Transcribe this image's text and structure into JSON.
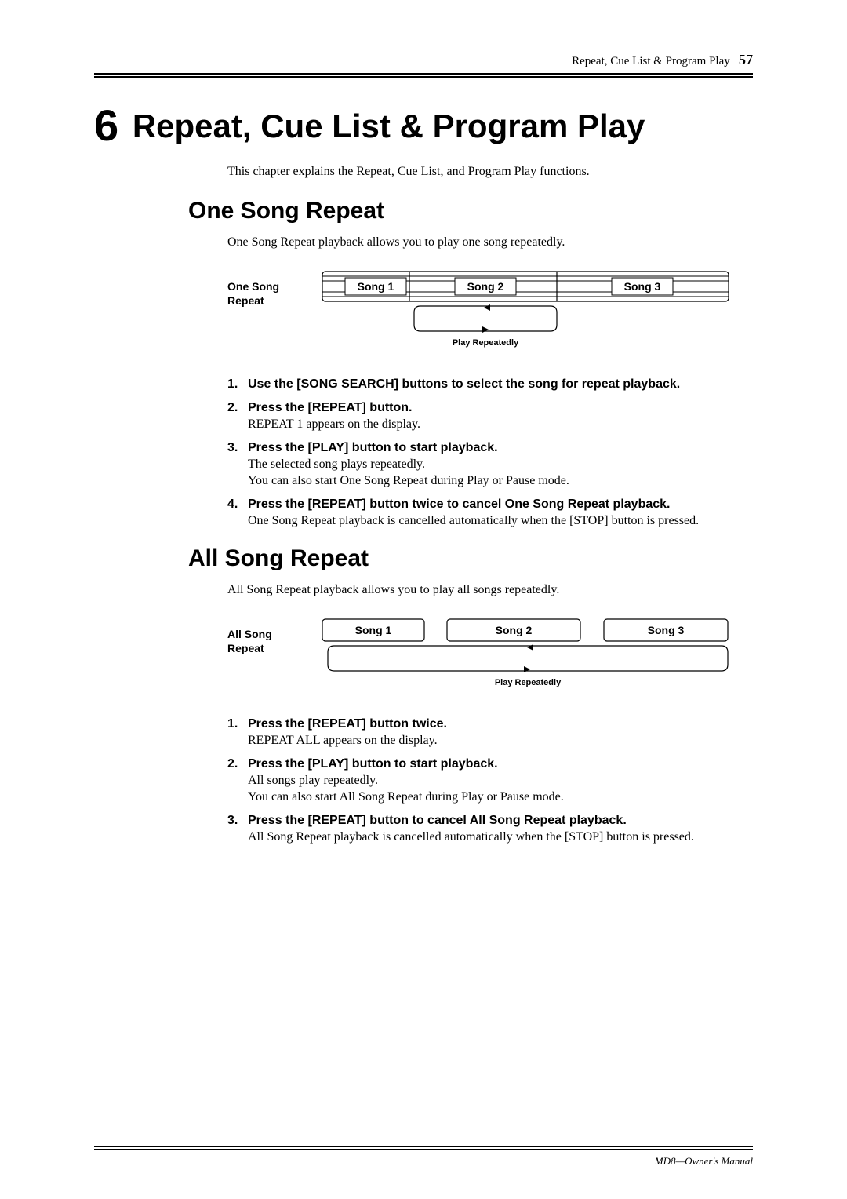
{
  "header": {
    "running_title": "Repeat, Cue List & Program Play",
    "page_number": "57"
  },
  "chapter": {
    "number": "6",
    "title": "Repeat, Cue List & Program Play",
    "intro": "This chapter explains the Repeat, Cue List, and Program Play functions."
  },
  "sections": [
    {
      "heading": "One Song Repeat",
      "intro": "One Song Repeat playback allows you to play one song repeatedly.",
      "diagram": {
        "label_line1": "One Song",
        "label_line2": "Repeat",
        "songs": [
          "Song 1",
          "Song 2",
          "Song 3"
        ],
        "caption": "Play Repeatedly"
      },
      "steps": [
        {
          "num": "1.",
          "head": "Use the [SONG SEARCH] buttons to select the song for repeat playback.",
          "body": []
        },
        {
          "num": "2.",
          "head": "Press the [REPEAT] button.",
          "body": [
            "REPEAT 1 appears on the display."
          ]
        },
        {
          "num": "3.",
          "head": "Press the [PLAY] button to start playback.",
          "body": [
            "The selected song plays repeatedly.",
            "You can also start One Song Repeat during Play or Pause mode."
          ]
        },
        {
          "num": "4.",
          "head": "Press the [REPEAT] button twice to cancel One Song Repeat playback.",
          "body": [
            "One Song Repeat playback is cancelled automatically when the [STOP] button is pressed."
          ]
        }
      ]
    },
    {
      "heading": "All Song Repeat",
      "intro": "All Song Repeat playback allows you to play all songs repeatedly.",
      "diagram": {
        "label_line1": "All Song",
        "label_line2": "Repeat",
        "songs": [
          "Song 1",
          "Song 2",
          "Song 3"
        ],
        "caption": "Play Repeatedly"
      },
      "steps": [
        {
          "num": "1.",
          "head": "Press the [REPEAT] button twice.",
          "body": [
            "REPEAT ALL appears on the display."
          ]
        },
        {
          "num": "2.",
          "head": "Press the [PLAY] button to start playback.",
          "body": [
            "All songs play repeatedly.",
            "You can also start All Song Repeat during Play or Pause mode."
          ]
        },
        {
          "num": "3.",
          "head": "Press the [REPEAT] button to cancel All Song Repeat playback.",
          "body": [
            "All Song Repeat playback is cancelled automatically when the [STOP] button is pressed."
          ]
        }
      ]
    }
  ],
  "footer": {
    "text": "MD8—Owner's Manual"
  }
}
